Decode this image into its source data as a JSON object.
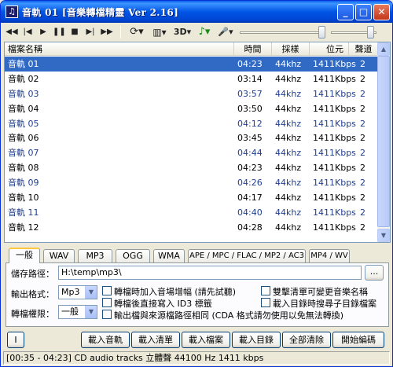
{
  "window": {
    "title": "音軌 01 [音樂轉檔精靈 Ver 2.16]",
    "app_icon_glyph": "♫",
    "minimize_glyph": "_",
    "maximize_glyph": "□",
    "close_glyph": "✕"
  },
  "toolbar": {
    "play_glyph": "◀◀",
    "glyph_rewind": "◀◀",
    "glyph_prev": "|◀",
    "glyph_play": "▶",
    "glyph_pause": "❚❚",
    "glyph_stop": "■",
    "glyph_next": "▶|",
    "glyph_ffwd": "▶▶",
    "repeat_glyph": "⟳▾",
    "eq_glyph": "▥▾",
    "label_3d": "3D▾",
    "effect_glyph": "♪▾",
    "mic_glyph": "🎤▾"
  },
  "list": {
    "columns": [
      "檔案名稱",
      "時間",
      "採樣",
      "位元",
      "聲道"
    ],
    "rows": [
      {
        "name": "音軌 01",
        "time": "04:23",
        "sample": "44khz",
        "bitrate": "1411Kbps",
        "channels": "2"
      },
      {
        "name": "音軌 02",
        "time": "03:14",
        "sample": "44khz",
        "bitrate": "1411Kbps",
        "channels": "2"
      },
      {
        "name": "音軌 03",
        "time": "03:57",
        "sample": "44khz",
        "bitrate": "1411Kbps",
        "channels": "2"
      },
      {
        "name": "音軌 04",
        "time": "03:50",
        "sample": "44khz",
        "bitrate": "1411Kbps",
        "channels": "2"
      },
      {
        "name": "音軌 05",
        "time": "04:12",
        "sample": "44khz",
        "bitrate": "1411Kbps",
        "channels": "2"
      },
      {
        "name": "音軌 06",
        "time": "03:45",
        "sample": "44khz",
        "bitrate": "1411Kbps",
        "channels": "2"
      },
      {
        "name": "音軌 07",
        "time": "04:44",
        "sample": "44khz",
        "bitrate": "1411Kbps",
        "channels": "2"
      },
      {
        "name": "音軌 08",
        "time": "04:23",
        "sample": "44khz",
        "bitrate": "1411Kbps",
        "channels": "2"
      },
      {
        "name": "音軌 09",
        "time": "04:26",
        "sample": "44khz",
        "bitrate": "1411Kbps",
        "channels": "2"
      },
      {
        "name": "音軌 10",
        "time": "04:17",
        "sample": "44khz",
        "bitrate": "1411Kbps",
        "channels": "2"
      },
      {
        "name": "音軌 11",
        "time": "04:40",
        "sample": "44khz",
        "bitrate": "1411Kbps",
        "channels": "2"
      },
      {
        "name": "音軌 12",
        "time": "04:28",
        "sample": "44khz",
        "bitrate": "1411Kbps",
        "channels": "2"
      }
    ],
    "selected_index": 0,
    "scroll_up_glyph": "▲",
    "scroll_down_glyph": "▼"
  },
  "tabs": [
    "一般",
    "WAV",
    "MP3",
    "OGG",
    "WMA",
    "APE / MPC / FLAC / MP2 / AC3",
    "MP4 / WV"
  ],
  "settings": {
    "save_path_label": "儲存路徑：",
    "save_path_value": "H:\\temp\\mp3\\",
    "browse_label": "...",
    "format_label": "輸出格式：",
    "format_value": "Mp3",
    "priority_label": "轉檔權限：",
    "priority_value": "一般",
    "options": [
      "轉檔時加入音場增幅 (請先試聽)",
      "轉檔後直接寫入 ID3 標籤",
      "輸出檔與來源檔路徑相同 (CDA 格式請勿使用以免無法轉換)",
      "雙擊清單可變更音樂名稱",
      "載入目錄時搜尋子目錄檔案"
    ]
  },
  "buttons": {
    "info_label": "I",
    "load_audio": "載入音軌",
    "load_list": "載入清單",
    "load_file": "載入檔案",
    "load_folder": "載入目錄",
    "clear_all": "全部清除",
    "start_convert": "開始編碼"
  },
  "status": {
    "text": "[00:35 - 04:23] CD audio tracks 立體聲 44100 Hz 1411 kbps"
  },
  "sliders": {
    "volume_level": 0.97,
    "position_level": 0.88
  }
}
